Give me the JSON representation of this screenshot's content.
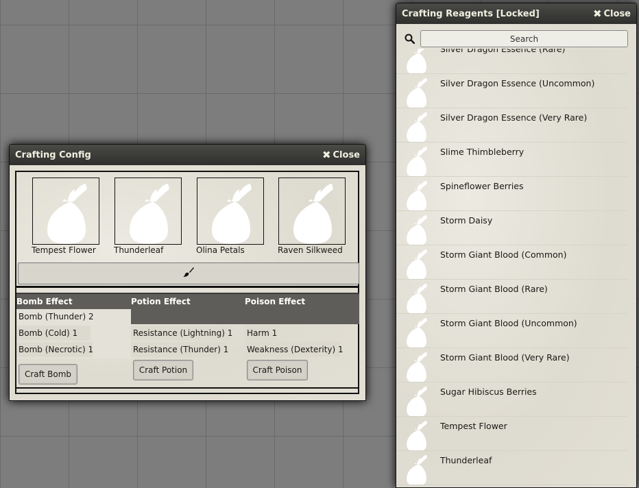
{
  "config_window": {
    "title": "Crafting Config",
    "close_label": "Close",
    "slots": [
      {
        "label": "Tempest Flower",
        "icon": "pouch-icon"
      },
      {
        "label": "Thunderleaf",
        "icon": "pouch-icon"
      },
      {
        "label": "Olina Petals",
        "icon": "pouch-icon"
      },
      {
        "label": "Raven Silkweed",
        "icon": "pouch-icon"
      }
    ],
    "brush_icon": "paintbrush-icon",
    "headers": {
      "bomb": "Bomb Effect",
      "potion": "Potion Effect",
      "poison": "Poison Effect"
    },
    "bomb_effects": [
      "Bomb (Thunder) 2",
      "Bomb (Cold) 1",
      "Bomb (Necrotic) 1"
    ],
    "potion_effects": [
      "Resistance (Lightning) 1",
      "Resistance (Thunder) 1"
    ],
    "poison_effects": [
      "Harm 1",
      "Weakness (Dexterity) 1"
    ],
    "buttons": {
      "bomb": "Craft Bomb",
      "potion": "Craft Potion",
      "poison": "Craft Poison"
    }
  },
  "reagents_window": {
    "title": "Crafting Reagents [Locked]",
    "close_label": "Close",
    "search_placeholder": "Search",
    "items": [
      "Silver Dragon Essence (Rare)",
      "Silver Dragon Essence (Uncommon)",
      "Silver Dragon Essence (Very Rare)",
      "Slime Thimbleberry",
      "Spineflower Berries",
      "Storm Daisy",
      "Storm Giant Blood (Common)",
      "Storm Giant Blood (Rare)",
      "Storm Giant Blood (Uncommon)",
      "Storm Giant Blood (Very Rare)",
      "Sugar Hibiscus Berries",
      "Tempest Flower",
      "Thunderleaf"
    ]
  }
}
